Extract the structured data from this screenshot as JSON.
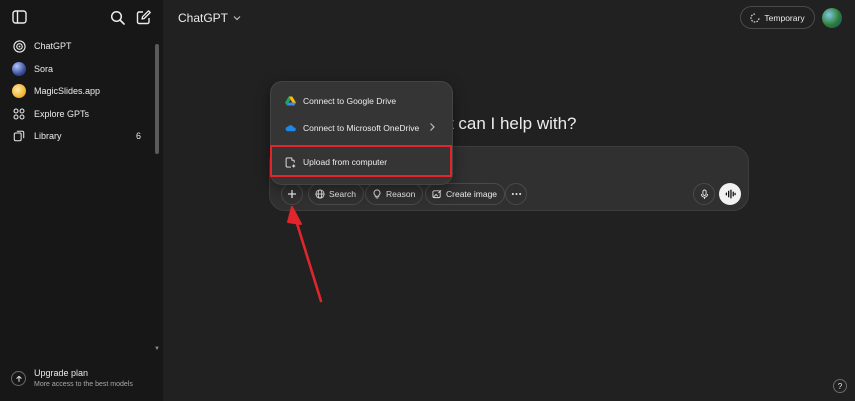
{
  "sidebar": {
    "items": [
      {
        "label": "ChatGPT",
        "icon": "chatgpt-logo-icon"
      },
      {
        "label": "Sora",
        "icon": "sora-icon"
      },
      {
        "label": "MagicSlides.app",
        "icon": "magicslides-icon"
      },
      {
        "label": "Explore GPTs",
        "icon": "grid-icon"
      },
      {
        "label": "Library",
        "icon": "library-icon",
        "count": "6"
      }
    ],
    "upgrade": {
      "title": "Upgrade plan",
      "subtitle": "More access to the best models"
    }
  },
  "header": {
    "model": "ChatGPT",
    "temporary_label": "Temporary"
  },
  "main": {
    "headline": "at can I help with?",
    "composer": {
      "search_label": "Search",
      "reason_label": "Reason",
      "create_image_label": "Create image"
    },
    "attach_menu": {
      "items": [
        {
          "label": "Connect to Google Drive"
        },
        {
          "label": "Connect to Microsoft OneDrive"
        },
        {
          "label": "Upload from computer"
        }
      ]
    }
  },
  "help_label": "?",
  "colors": {
    "background": "#212121",
    "sidebar": "#171717",
    "annotation_red": "#e0252c"
  }
}
